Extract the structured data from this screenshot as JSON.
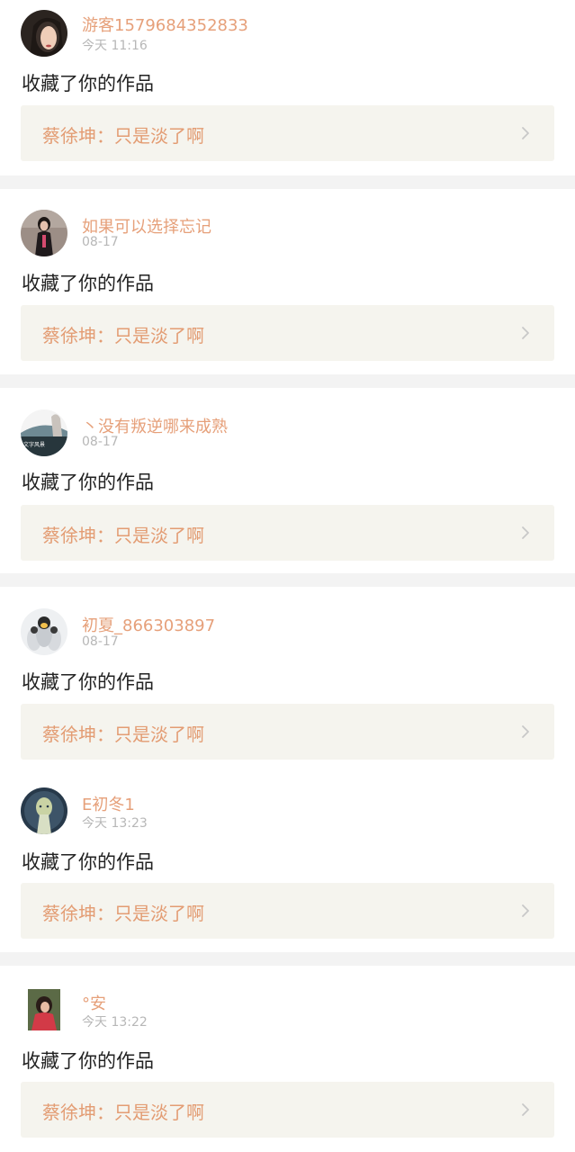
{
  "feed": {
    "items": [
      {
        "username": "游客1579684352833",
        "time": "今天 11:16",
        "action": "收藏了你的作品",
        "work": "蔡徐坤：只是淡了啊",
        "avatar_icon": "user-avatar-girl-dark-hair"
      },
      {
        "username": "如果可以选择忘记",
        "time": "08-17",
        "action": "收藏了你的作品",
        "work": "蔡徐坤：只是淡了啊",
        "avatar_icon": "user-avatar-girl-standing"
      },
      {
        "username": "丶没有叛逆哪来成熟",
        "time": "08-17",
        "action": "收藏了你的作品",
        "work": "蔡徐坤：只是淡了啊",
        "avatar_icon": "user-avatar-scenery-text"
      },
      {
        "username": "初夏_866303897",
        "time": "08-17",
        "action": "收藏了你的作品",
        "work": "蔡徐坤：只是淡了啊",
        "avatar_icon": "user-avatar-penguins"
      },
      {
        "username": "E初冬1",
        "time": "今天 13:23",
        "action": "收藏了你的作品",
        "work": "蔡徐坤：只是淡了啊",
        "avatar_icon": "user-avatar-anime-girl"
      },
      {
        "username": "°安",
        "time": "今天 13:22",
        "action": "收藏了你的作品",
        "work": "蔡徐坤：只是淡了啊",
        "avatar_icon": "user-avatar-girl-red"
      }
    ]
  },
  "colors": {
    "username": "#e6a07a",
    "work_title": "#e39c73",
    "work_bg": "#f5f4ee",
    "separator": "#f3f3f3",
    "time": "#b7b7b7",
    "action": "#222222"
  }
}
